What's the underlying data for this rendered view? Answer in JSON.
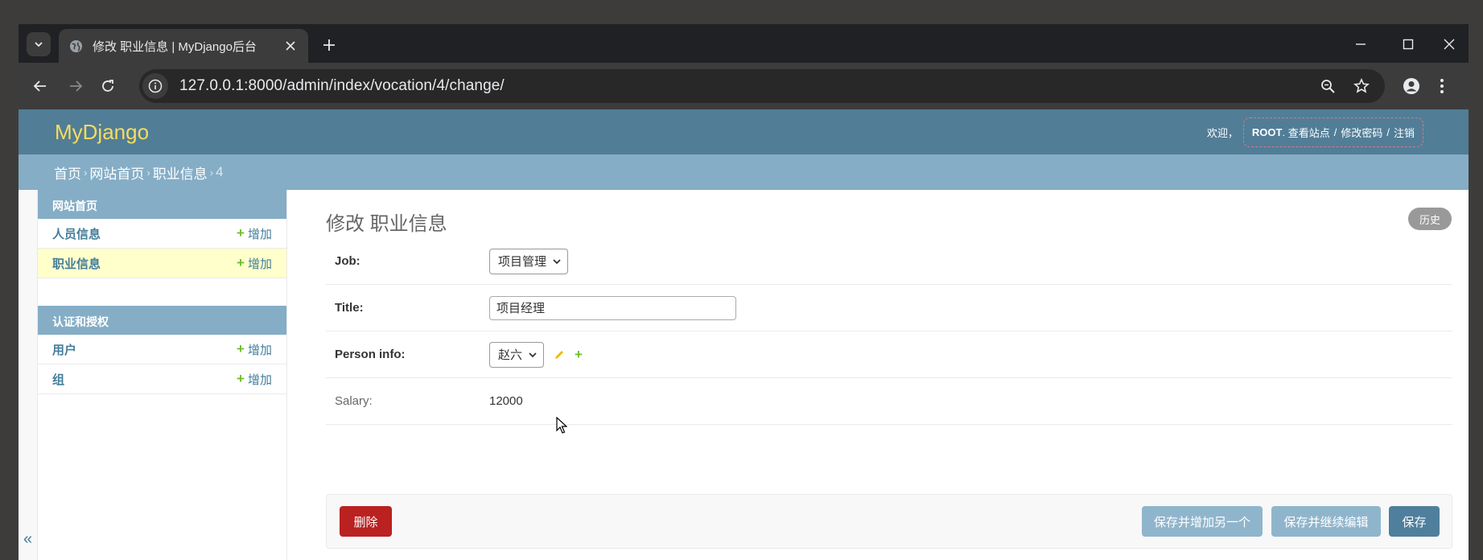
{
  "browser": {
    "tab_title": "修改 职业信息 | MyDjango后台",
    "url": "127.0.0.1:8000/admin/index/vocation/4/change/"
  },
  "header": {
    "branding": "MyDjango",
    "welcome": "欢迎，",
    "username": "ROOT",
    "view_site": "查看站点",
    "change_password": "修改密码",
    "logout": "注销",
    "separator": "/"
  },
  "breadcrumbs": {
    "home": "首页",
    "app": "网站首页",
    "model": "职业信息",
    "current": "4",
    "arrow": "›"
  },
  "sidebar": {
    "modules": [
      {
        "caption": "网站首页",
        "rows": [
          {
            "label": "人员信息",
            "add": "增加"
          },
          {
            "label": "职业信息",
            "add": "增加"
          }
        ]
      },
      {
        "caption": "认证和授权",
        "rows": [
          {
            "label": "用户",
            "add": "增加"
          },
          {
            "label": "组",
            "add": "增加"
          }
        ]
      }
    ],
    "collapse_glyph": "«"
  },
  "content": {
    "title": "修改 职业信息",
    "history": "历史",
    "fields": {
      "job": {
        "label": "Job:",
        "value": "项目管理"
      },
      "title": {
        "label": "Title:",
        "value": "项目经理"
      },
      "person_info": {
        "label": "Person info:",
        "value": "赵六"
      },
      "salary": {
        "label": "Salary:",
        "value": "12000"
      }
    },
    "buttons": {
      "delete": "删除",
      "save_and_add": "保存并增加另一个",
      "save_and_continue": "保存并继续编辑",
      "save": "保存"
    }
  },
  "colors": {
    "header_bg": "#527d97",
    "breadcrumb_bg": "#85adc6",
    "branding": "#f5dd5d",
    "link": "#447e9b",
    "add_plus": "#70bf2b",
    "delete_btn": "#ba2121",
    "selected_row": "#ffffcc"
  }
}
